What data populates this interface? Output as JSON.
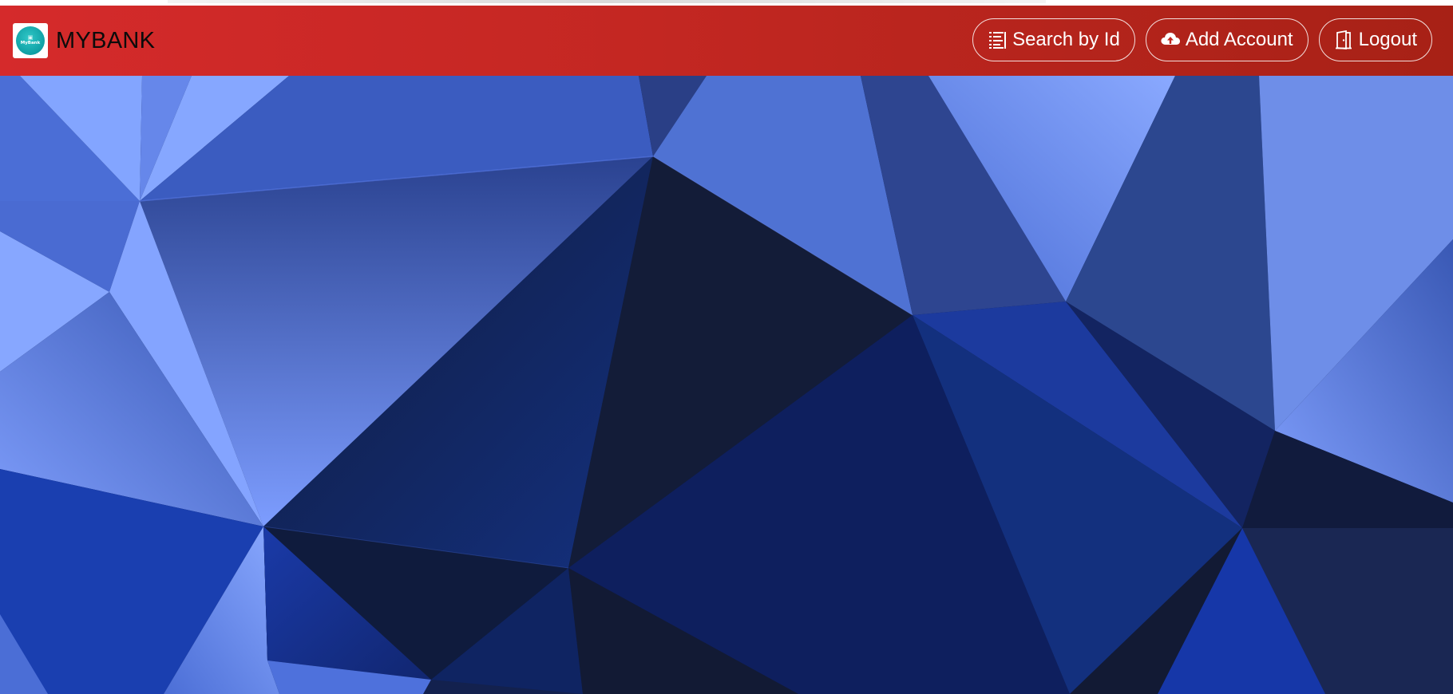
{
  "brand": {
    "logo_text": "MyBank",
    "name": "MYBANK"
  },
  "nav": {
    "buttons": [
      {
        "label": "Search by Id",
        "icon": "list-icon"
      },
      {
        "label": "Add Account",
        "icon": "cloud-upload-icon"
      },
      {
        "label": "Logout",
        "icon": "door-icon"
      }
    ]
  },
  "colors": {
    "navbar_start": "#d52a2b",
    "navbar_end": "#a72116",
    "hero_light": "#83a4ff",
    "hero_dark": "#121a34",
    "logo_teal": "#0f9fa4"
  }
}
